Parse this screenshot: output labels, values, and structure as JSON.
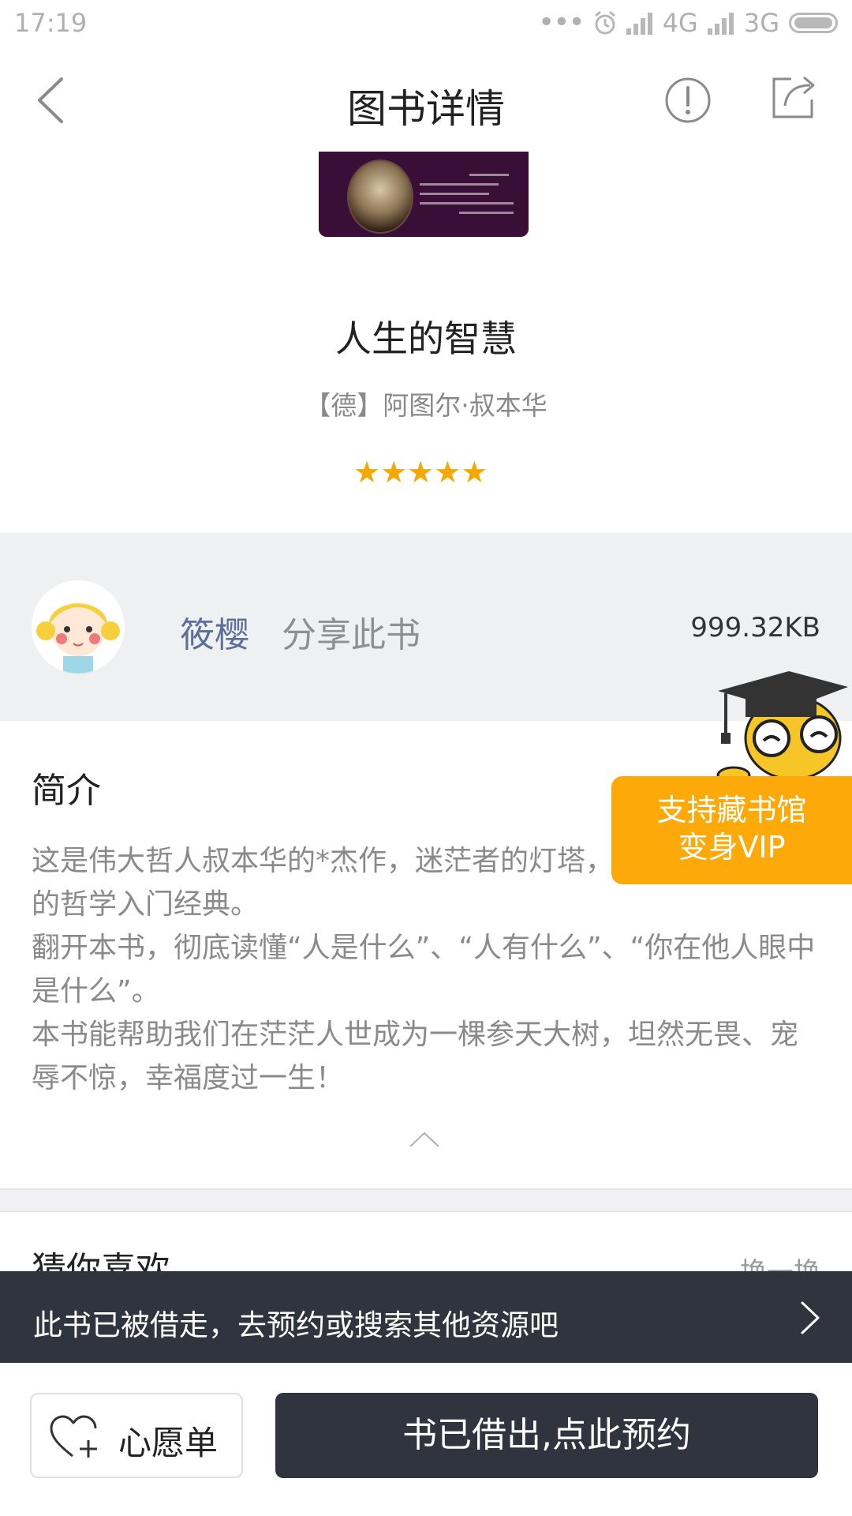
{
  "status_bar": {
    "time": "17:19",
    "dots": "•••",
    "network_1": "4G",
    "network_2": "3G"
  },
  "nav": {
    "title": "图书详情",
    "back_icon": "chevron-left-icon",
    "info_icon": "exclamation-circle-icon",
    "share_icon": "share-icon"
  },
  "book": {
    "title": "人生的智慧",
    "author": "【德】阿图尔·叔本华",
    "rating": 5,
    "stars": "★★★★★",
    "star_color": "#f7a800"
  },
  "share": {
    "user_name": "筱樱",
    "action": "分享此书",
    "file_size": "999.32KB"
  },
  "intro": {
    "heading": "简介",
    "paragraphs": [
      "这是伟大哲人叔本华的*杰作，迷茫者的灯塔，被誉为通俗实用的哲学入门经典。",
      "翻开本书，彻底读懂“人是什么”、“人有什么”、“你在他人眼中是什么”。",
      "本书能帮助我们在茫茫人世成为一棵参天大树，坦然无畏、宠辱不惊，幸福度过一生！"
    ]
  },
  "guess": {
    "title": "猜你喜欢",
    "refresh": "换一换"
  },
  "vip": {
    "line1": "支持藏书馆",
    "line2": "变身VIP",
    "color": "#fda90a"
  },
  "borrowed_banner": {
    "text": "此书已被借走，去预约或搜索其他资源吧"
  },
  "bottom_bar": {
    "wishlist_label": "心愿单",
    "reserve_label": "书已借出,点此预约",
    "dark_color": "#2f343f"
  }
}
